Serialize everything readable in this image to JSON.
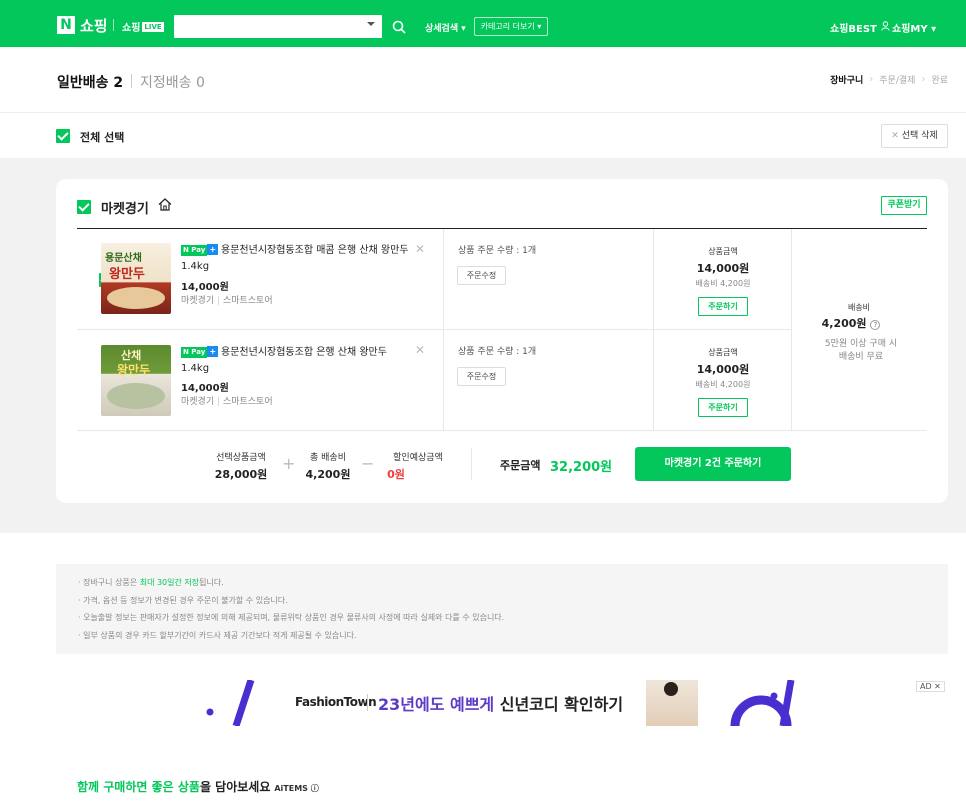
{
  "header": {
    "logo_mark": "N",
    "logo_text": "쇼핑",
    "live_text": "쇼핑",
    "live_badge": "LIVE",
    "search": {
      "placeholder": ""
    },
    "advanced_search": "상세검색 ▾",
    "category_more": "카테고리 더보기 ▾",
    "best": "쇼핑BEST",
    "my": "쇼핑MY ▾",
    "brand_color": "#03c75a"
  },
  "tabs": {
    "general_delivery": "일반배송 2",
    "scheduled_delivery": "지정배송 0"
  },
  "steps": [
    "장바구니",
    "주문/결제",
    "완료"
  ],
  "selection": {
    "select_all": "전체 선택",
    "delete_selected": "선택 삭제"
  },
  "store": {
    "name": "마켓경기",
    "coupon_button": "쿠폰받기",
    "items": [
      {
        "thumb_top": "용문산채",
        "thumb_bottom": "왕만두",
        "npay": "N Pay",
        "npay_plus": "+",
        "name": "용문천년시장협동조합 매콤 은행 산채 왕만두 1.4kg",
        "price": "14,000원",
        "store_name": "마켓경기",
        "store_type": "스마트스토어",
        "quantity": "상품 주문 수량 : 1개",
        "modify_button": "주문수정",
        "amount_label": "상품금액",
        "amount": "14,000원",
        "shipping": "배송비 4,200원",
        "order_button": "주문하기"
      },
      {
        "thumb_top": "산채",
        "thumb_bottom": "왕만두",
        "npay": "N Pay",
        "npay_plus": "+",
        "name": "용문천년시장협동조합 은행 산채 왕만두 1.4kg",
        "price": "14,000원",
        "store_name": "마켓경기",
        "store_type": "스마트스토어",
        "quantity": "상품 주문 수량 : 1개",
        "modify_button": "주문수정",
        "amount_label": "상품금액",
        "amount": "14,000원",
        "shipping": "배송비 4,200원",
        "order_button": "주문하기"
      }
    ],
    "shipping_block": {
      "label": "배송비",
      "value": "4,200원",
      "note_line1": "5만원 이상 구매 시",
      "note_line2": "배송비 무료"
    },
    "summary": {
      "selected_label": "선택상품금액",
      "selected_value": "28,000원",
      "plus": "+",
      "shipping_label": "총 배송비",
      "shipping_value": "4,200원",
      "minus": "−",
      "discount_label": "할인예상금액",
      "discount_value": "0원",
      "order_label": "주문금액",
      "order_value": "32,200원",
      "order_button": "마켓경기 2건 주문하기"
    }
  },
  "notice": {
    "line1_pre": "· 장바구니 상품은 ",
    "line1_hl": "최대 30일간 저장",
    "line1_post": "됩니다.",
    "line2": "· 가격, 옵션 등 정보가 변경된 경우 주문이 불가할 수 있습니다.",
    "line3": "· 오늘출발 정보는 판매자가 설정한 정보에 의해 제공되며, 물류위탁 상품인 경우 물류사의 사정에 따라 실제와 다를 수 있습니다.",
    "line4": "· 일부 상품의 경우 카드 할부기간이 카드사 제공 기간보다 적게 제공될 수 있습니다."
  },
  "ad": {
    "brand": "FashionTown",
    "copy_colored": "23년에도 예쁘게 ",
    "copy_bold": "신년코디 확인하기",
    "badge": "AD ✕"
  },
  "recommend": {
    "title_green": "함께 구매하면 좋은 상품",
    "title_rest": "을 담아보세요",
    "aitems": "AiTEMS ⓘ"
  }
}
